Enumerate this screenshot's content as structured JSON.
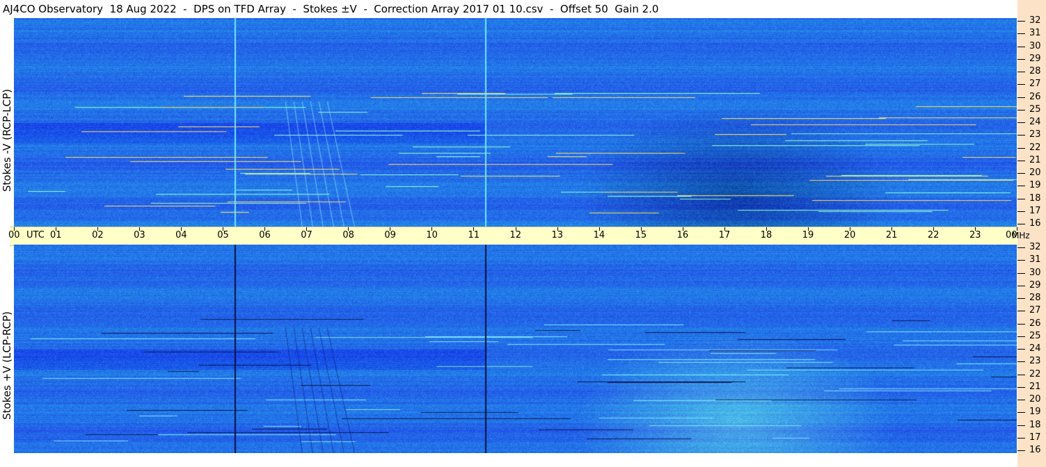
{
  "title": "AJ4CO Observatory  18 Aug 2022  -  DPS on TFD Array  -  Stokes ±V  -  Correction Array 2017 01 10.csv  -  Offset 50  Gain 2.0",
  "colors": {
    "time_axis_bg": "#ffffc8",
    "freq_axis_bg": "#fce3c8",
    "spectrogram_base": "#2a6ae8"
  },
  "chart_data": [
    {
      "type": "heatmap",
      "name": "Stokes -V (RCP-LCP)",
      "ylabel": "Stokes -V (RCP-LCP)",
      "x_unit": "UTC",
      "y_unit": "MHz",
      "xlim": [
        "00",
        "00"
      ],
      "ylim": [
        16,
        32
      ],
      "y_ticks": [
        16,
        17,
        18,
        19,
        20,
        21,
        22,
        23,
        24,
        25,
        26,
        27,
        28,
        29,
        30,
        31,
        32
      ],
      "x_ticks": [
        "00",
        "01",
        "02",
        "03",
        "04",
        "05",
        "06",
        "07",
        "08",
        "09",
        "10",
        "11",
        "12",
        "13",
        "14",
        "15",
        "16",
        "17",
        "18",
        "19",
        "20",
        "21",
        "22",
        "23",
        "00"
      ]
    },
    {
      "type": "heatmap",
      "name": "Stokes +V (LCP-RCP)",
      "ylabel": "Stokes +V (LCP-RCP)",
      "x_unit": "UTC",
      "y_unit": "MHz",
      "xlim": [
        "00",
        "00"
      ],
      "ylim": [
        16,
        32
      ],
      "y_ticks": [
        16,
        17,
        18,
        19,
        20,
        21,
        22,
        23,
        24,
        25,
        26,
        27,
        28,
        29,
        30,
        31,
        32
      ],
      "x_ticks": [
        "00",
        "01",
        "02",
        "03",
        "04",
        "05",
        "06",
        "07",
        "08",
        "09",
        "10",
        "11",
        "12",
        "13",
        "14",
        "15",
        "16",
        "17",
        "18",
        "19",
        "20",
        "21",
        "22",
        "23",
        "00"
      ]
    }
  ],
  "time_axis": {
    "unit_label": "UTC",
    "freq_unit_label": "MHz",
    "hours": [
      "00",
      "01",
      "02",
      "03",
      "04",
      "05",
      "06",
      "07",
      "08",
      "09",
      "10",
      "11",
      "12",
      "13",
      "14",
      "15",
      "16",
      "17",
      "18",
      "19",
      "20",
      "21",
      "22",
      "23",
      "00"
    ]
  },
  "freq_axis": {
    "ticks": [
      32,
      31,
      30,
      29,
      28,
      27,
      26,
      25,
      24,
      23,
      22,
      21,
      20,
      19,
      18,
      17,
      16
    ]
  }
}
